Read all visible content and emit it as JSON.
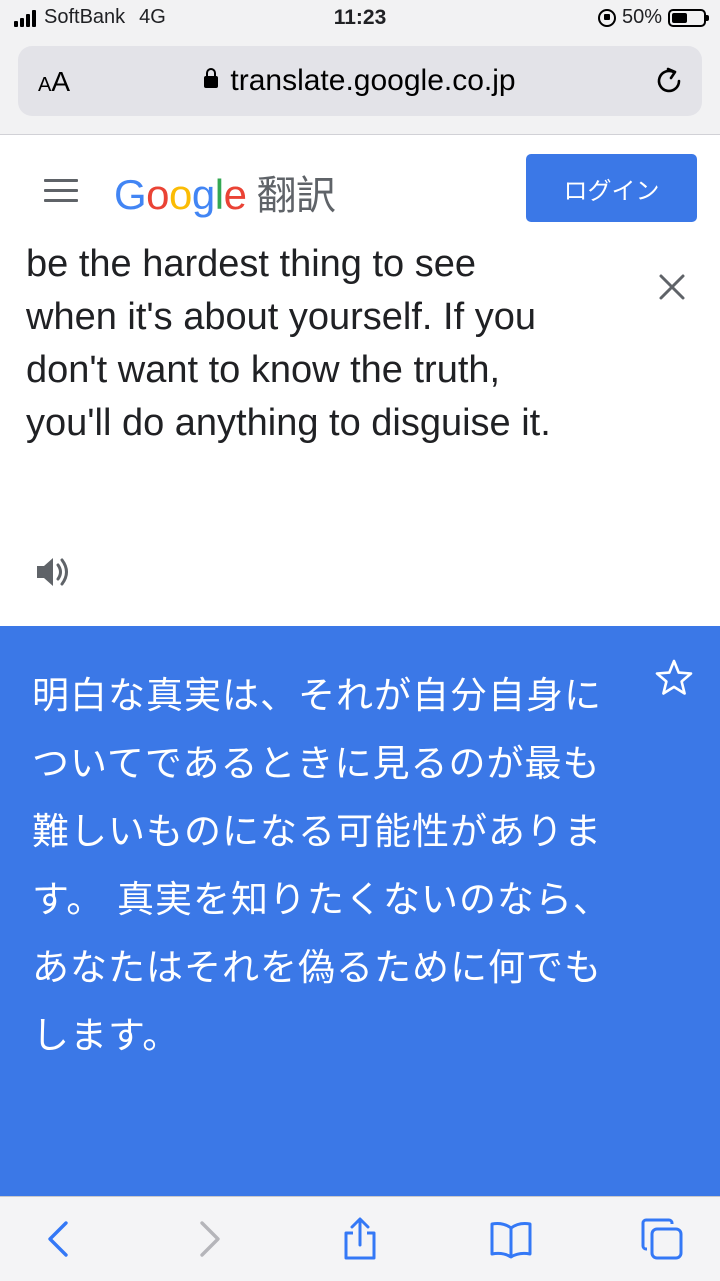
{
  "status_bar": {
    "carrier": "SoftBank",
    "network": "4G",
    "time": "11:23",
    "battery_percent": "50%",
    "battery_level": 0.5
  },
  "browser": {
    "text_size_label": "AA",
    "url": "translate.google.co.jp"
  },
  "header": {
    "logo_text": "Google",
    "product": "翻訳",
    "login_label": "ログイン"
  },
  "source": {
    "text": "The obvious truth is that it can be the hardest thing to see when it's about yourself. If you don't want to know the truth, you'll do anything to disguise it."
  },
  "result": {
    "text": "明白な真実は、それが自分自身についてであるときに見るのが最も難しいものになる可能性があります。 真実を知りたくないのなら、あなたはそれを偽るために何でもします。"
  },
  "colors": {
    "accent": "#3b78e7",
    "browser_chrome": "#f2f2f3",
    "url_field": "#e3e3e8",
    "toolbar_icon": "#3478f6"
  }
}
